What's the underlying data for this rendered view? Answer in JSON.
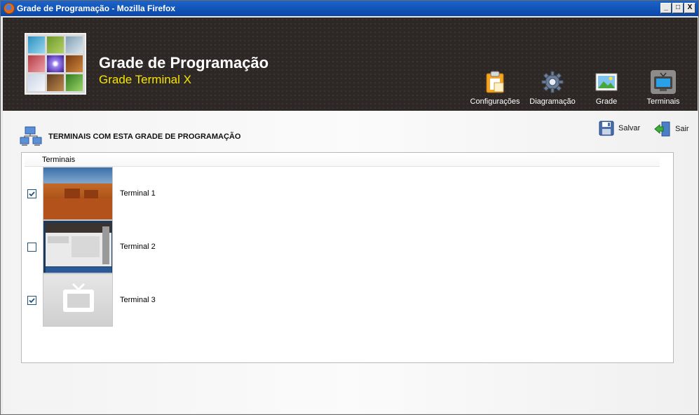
{
  "window": {
    "title": "Grade de Programação - Mozilla Firefox",
    "controls": [
      "_",
      "□",
      "X"
    ]
  },
  "header": {
    "title": "Grade de Programação",
    "subtitle": "Grade Terminal X"
  },
  "nav": [
    {
      "label": "Configurações",
      "icon": "clipboard-icon"
    },
    {
      "label": "Diagramação",
      "icon": "gear-icon"
    },
    {
      "label": "Grade",
      "icon": "picture-icon"
    },
    {
      "label": "Terminais",
      "icon": "tv-icon"
    }
  ],
  "section": {
    "title": "TERMINAIS COM ESTA GRADE DE PROGRAMAÇÃO",
    "icon": "network-icon"
  },
  "actions": {
    "save_label": "Salvar",
    "exit_label": "Sair"
  },
  "table": {
    "column_header": "Terminais",
    "rows": [
      {
        "label": "Terminal 1",
        "checked": true,
        "thumb": "desert-landscape"
      },
      {
        "label": "Terminal 2",
        "checked": false,
        "thumb": "screen-capture"
      },
      {
        "label": "Terminal 3",
        "checked": true,
        "thumb": "tv-placeholder"
      }
    ]
  },
  "colors": {
    "header_bg": "#2d2725",
    "subtitle": "#f5e400",
    "titlebar": "#0a46a8",
    "check": "#1c5180"
  }
}
